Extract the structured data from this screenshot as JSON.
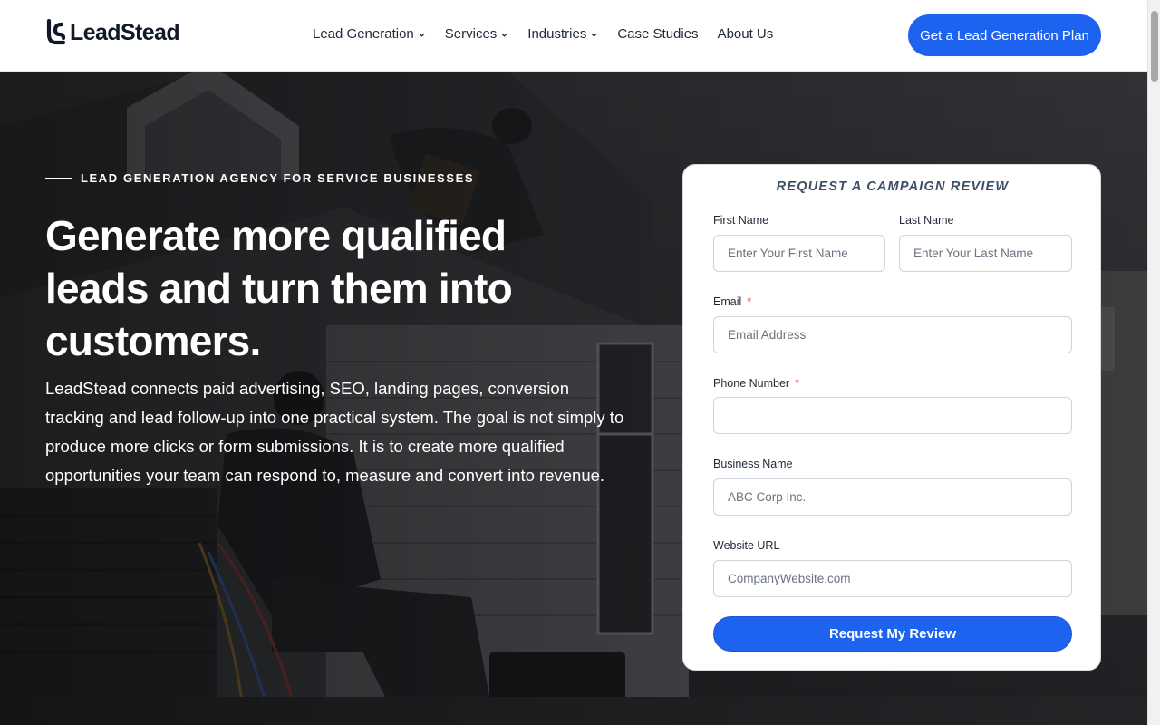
{
  "brand": {
    "name": "LeadStead",
    "accent_color": "#1e63f0"
  },
  "nav": {
    "items": [
      {
        "label": "Lead Generation",
        "has_dropdown": true
      },
      {
        "label": "Services",
        "has_dropdown": true
      },
      {
        "label": "Industries",
        "has_dropdown": true
      },
      {
        "label": "Case Studies",
        "has_dropdown": false
      },
      {
        "label": "About Us",
        "has_dropdown": false
      }
    ],
    "cta_label": "Get a Lead Generation Plan"
  },
  "hero": {
    "eyebrow": "LEAD GENERATION AGENCY FOR SERVICE BUSINESSES",
    "headline": "Generate more qualified leads and turn them into customers.",
    "body": "LeadStead connects paid advertising, SEO, landing pages, conversion tracking and lead follow-up into one practical system. The goal is not simply to produce more clicks or form submissions. It is to create more qualified opportunities your team can respond to, measure and convert into revenue."
  },
  "form": {
    "title": "REQUEST A CAMPAIGN REVIEW",
    "fields": {
      "first_name": {
        "label": "First Name",
        "placeholder": "Enter Your First Name",
        "required": false
      },
      "last_name": {
        "label": "Last Name",
        "placeholder": "Enter Your Last Name",
        "required": false
      },
      "email": {
        "label": "Email",
        "placeholder": "Email Address",
        "required": true
      },
      "phone": {
        "label": "Phone Number",
        "placeholder": "",
        "required": true
      },
      "business": {
        "label": "Business Name",
        "placeholder": "ABC Corp Inc.",
        "required": false
      },
      "website": {
        "label": "Website URL",
        "placeholder": "CompanyWebsite.com",
        "required": false
      }
    },
    "required_marker": "*",
    "submit_label": "Request My Review"
  },
  "icons": {
    "logo": "leadstead-logo-icon",
    "dropdown": "chevron-down-icon"
  }
}
